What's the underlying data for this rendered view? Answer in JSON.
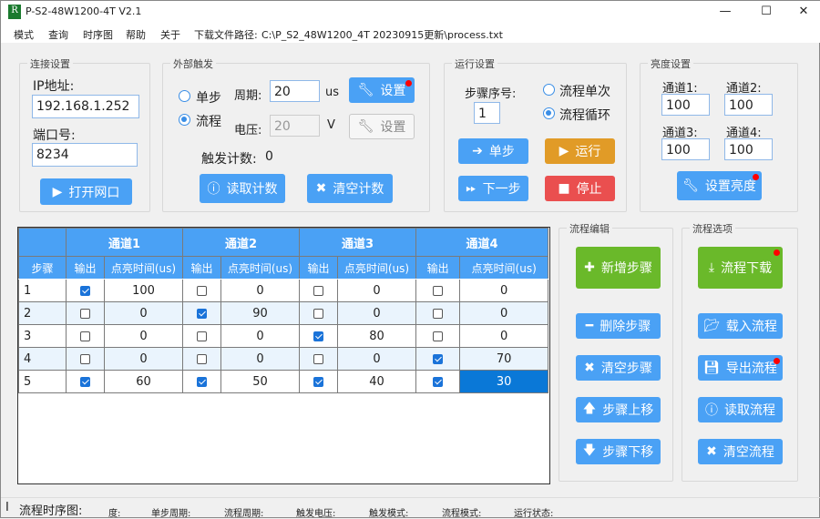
{
  "window": {
    "title": "P-S2-48W1200-4T V2.1",
    "logo": "R",
    "minimize": "—",
    "maximize": "☐",
    "close": "✕"
  },
  "menu": {
    "items": [
      "模式",
      "查询",
      "时序图",
      "帮助",
      "关于"
    ],
    "path_label": "下载文件路径:",
    "path": "C:\\P_S2_48W1200_4T 20230915更新\\process.txt"
  },
  "connection": {
    "title": "连接设置",
    "ip_label": "IP地址:",
    "ip": "192.168.1.252",
    "port_label": "端口号:",
    "port": "8234",
    "open_button": "打开网口"
  },
  "trigger": {
    "title": "外部触发",
    "single": "单步",
    "flow": "流程",
    "selected": "flow",
    "period_label": "周期:",
    "period": "20",
    "period_unit": "us",
    "voltage_label": "电压:",
    "voltage": "20",
    "voltage_unit": "V",
    "set1": "设置",
    "set2": "设置",
    "count_label": "触发计数:",
    "count": "0",
    "read_count": "读取计数",
    "clear_count": "清空计数"
  },
  "run": {
    "title": "运行设置",
    "step_label": "步骤序号:",
    "step": "1",
    "once": "流程单次",
    "loop": "流程循环",
    "selected": "loop",
    "step_button": "单步",
    "run_button": "运行",
    "next_button": "下一步",
    "stop_button": "停止"
  },
  "brightness": {
    "title": "亮度设置",
    "channels": [
      {
        "label": "通道1:",
        "value": "100"
      },
      {
        "label": "通道2:",
        "value": "100"
      },
      {
        "label": "通道3:",
        "value": "100"
      },
      {
        "label": "通道4:",
        "value": "100"
      }
    ],
    "set_button": "设置亮度"
  },
  "table": {
    "channels": [
      "通道1",
      "通道2",
      "通道3",
      "通道4"
    ],
    "step_header": "步骤",
    "out_header": "输出",
    "time_header": "点亮时间(us)",
    "rows": [
      {
        "step": "1",
        "ch": [
          [
            true,
            "100"
          ],
          [
            false,
            "0"
          ],
          [
            false,
            "0"
          ],
          [
            false,
            "0"
          ]
        ]
      },
      {
        "step": "2",
        "ch": [
          [
            false,
            "0"
          ],
          [
            true,
            "90"
          ],
          [
            false,
            "0"
          ],
          [
            false,
            "0"
          ]
        ]
      },
      {
        "step": "3",
        "ch": [
          [
            false,
            "0"
          ],
          [
            false,
            "0"
          ],
          [
            true,
            "80"
          ],
          [
            false,
            "0"
          ]
        ]
      },
      {
        "step": "4",
        "ch": [
          [
            false,
            "0"
          ],
          [
            false,
            "0"
          ],
          [
            false,
            "0"
          ],
          [
            true,
            "70"
          ]
        ]
      },
      {
        "step": "5",
        "ch": [
          [
            true,
            "60"
          ],
          [
            true,
            "50"
          ],
          [
            true,
            "40"
          ],
          [
            true,
            "30"
          ]
        ]
      }
    ]
  },
  "edit": {
    "title": "流程编辑",
    "add": "新增步骤",
    "delete": "删除步骤",
    "clear": "清空步骤",
    "up": "步骤上移",
    "down": "步骤下移"
  },
  "options": {
    "title": "流程选项",
    "download": "流程下载",
    "load": "载入流程",
    "export": "导出流程",
    "read": "读取流程",
    "clear": "清空流程"
  },
  "status": {
    "chart_label": "流程时序图:",
    "brightness": "度:",
    "step_period": "单步周期:",
    "flow_period": "流程周期:",
    "trigger_voltage": "触发电压:",
    "trigger_mode": "触发模式:",
    "flow_mode": "流程模式:",
    "run_state": "运行状态:"
  }
}
